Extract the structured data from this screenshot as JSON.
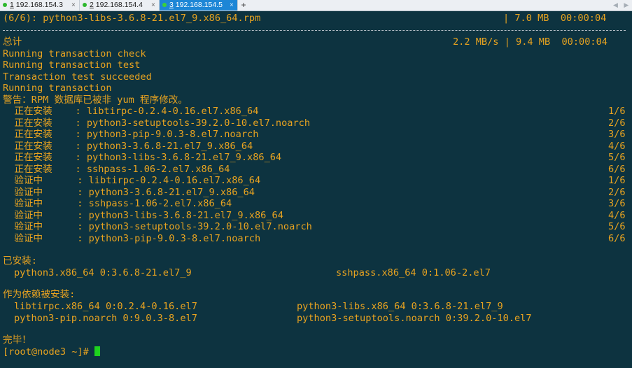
{
  "tabs": [
    {
      "num": "1",
      "host": "192.168.154.3",
      "active": false
    },
    {
      "num": "2",
      "host": "192.168.154.4",
      "active": false
    },
    {
      "num": "3",
      "host": "192.168.154.5",
      "active": true
    }
  ],
  "tab_close": "×",
  "new_tab": "+",
  "scroll_arrows": "◀ ▶",
  "terminal": {
    "header_left": "(6/6): python3-libs-3.6.8-21.el7_9.x86_64.rpm",
    "header_right": "| 7.0 MB  00:00:04",
    "total_left": "总计",
    "total_right": "2.2 MB/s | 9.4 MB  00:00:04",
    "status_lines": [
      "Running transaction check",
      "Running transaction test",
      "Transaction test succeeded",
      "Running transaction"
    ],
    "warning": "警告：RPM 数据库已被非 yum 程序修改。",
    "steps": [
      {
        "action": "  正在安装    : ",
        "pkg": "libtirpc-0.2.4-0.16.el7.x86_64",
        "count": "1/6"
      },
      {
        "action": "  正在安装    : ",
        "pkg": "python3-setuptools-39.2.0-10.el7.noarch",
        "count": "2/6"
      },
      {
        "action": "  正在安装    : ",
        "pkg": "python3-pip-9.0.3-8.el7.noarch",
        "count": "3/6"
      },
      {
        "action": "  正在安装    : ",
        "pkg": "python3-3.6.8-21.el7_9.x86_64",
        "count": "4/6"
      },
      {
        "action": "  正在安装    : ",
        "pkg": "python3-libs-3.6.8-21.el7_9.x86_64",
        "count": "5/6"
      },
      {
        "action": "  正在安装    : ",
        "pkg": "sshpass-1.06-2.el7.x86_64",
        "count": "6/6"
      },
      {
        "action": "  验证中      : ",
        "pkg": "libtirpc-0.2.4-0.16.el7.x86_64",
        "count": "1/6"
      },
      {
        "action": "  验证中      : ",
        "pkg": "python3-3.6.8-21.el7_9.x86_64",
        "count": "2/6"
      },
      {
        "action": "  验证中      : ",
        "pkg": "sshpass-1.06-2.el7.x86_64",
        "count": "3/6"
      },
      {
        "action": "  验证中      : ",
        "pkg": "python3-libs-3.6.8-21.el7_9.x86_64",
        "count": "4/6"
      },
      {
        "action": "  验证中      : ",
        "pkg": "python3-setuptools-39.2.0-10.el7.noarch",
        "count": "5/6"
      },
      {
        "action": "  验证中      : ",
        "pkg": "python3-pip-9.0.3-8.el7.noarch",
        "count": "6/6"
      }
    ],
    "installed_title": "已安装:",
    "installed": [
      "python3.x86_64 0:3.6.8-21.el7_9",
      "sshpass.x86_64 0:1.06-2.el7"
    ],
    "deps_title": "作为依赖被安装:",
    "deps": [
      "libtirpc.x86_64 0:0.2.4-0.16.el7",
      "python3-libs.x86_64 0:3.6.8-21.el7_9",
      "python3-pip.noarch 0:9.0.3-8.el7",
      "python3-setuptools.noarch 0:39.2.0-10.el7"
    ],
    "done": "完毕！",
    "prompt": "[root@node3 ~]# "
  },
  "colors": {
    "background": "#0d3340",
    "orange_text": "#e8a320",
    "white_text": "#e9e9e9",
    "cursor": "#1ed31e",
    "active_tab": "#1d86d6"
  }
}
